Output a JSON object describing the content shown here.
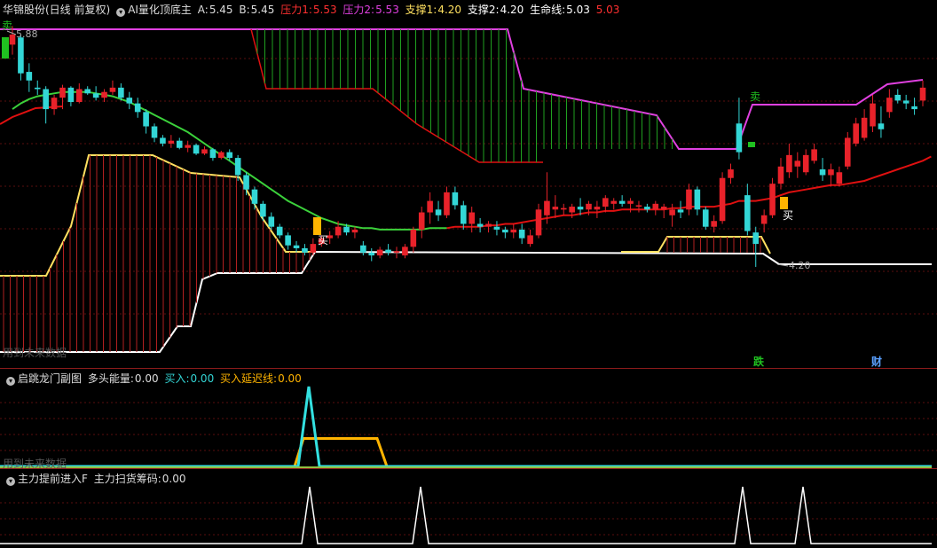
{
  "colors": {
    "up": "#e8222a",
    "down": "#33d6d6",
    "pressure": "#e01010",
    "support": "#ffe060",
    "life": "#3bd13b",
    "resist_top": "#e040e0",
    "white": "#ffffff",
    "buy_yellow": "#ffb400",
    "sell_green": "#20c020"
  },
  "main_header": {
    "stock": "华锦股份(日线 前复权)",
    "indicator": "AI量化顶底主",
    "a_label": "A:",
    "a_value": "5.45",
    "b_label": "B:",
    "b_value": "5.45",
    "p1_label": "压力1:",
    "p1_value": "5.53",
    "p2_label": "压力2:",
    "p2_value": "5.53",
    "s1_label": "支撑1:",
    "s1_value": "4.20",
    "s2_label": "支撑2:",
    "s2_value": "4.20",
    "life_label": "生命线:",
    "life_value": "5.03",
    "extra_value": "5.03"
  },
  "main_labels": {
    "high_price": "5.88",
    "low_price": "4.20",
    "buy": "买",
    "sell": "卖",
    "watermark": "用到未来数据",
    "event_die": "跌",
    "event_cai": "财"
  },
  "sub1_header": {
    "name": "启跳龙门副图",
    "e1_label": "多头能量:",
    "e1_value": "0.00",
    "e2_label": "买入:",
    "e2_value": "0.00",
    "e3_label": "买入延迟线:",
    "e3_value": "0.00",
    "watermark": "用到未来数据"
  },
  "sub2_header": {
    "name": "主力提前进入F",
    "e1_label": "主力扫货筹码:",
    "e1_value": "0.00"
  },
  "chart_data": [
    {
      "type": "candlestick",
      "title": "AI量化顶底主",
      "ylim": [
        3.6,
        5.95
      ],
      "candles": [
        [
          5.75,
          5.88,
          5.68,
          5.82
        ],
        [
          5.8,
          5.82,
          5.5,
          5.55
        ],
        [
          5.56,
          5.62,
          5.42,
          5.5
        ],
        [
          5.45,
          5.5,
          5.4,
          5.44
        ],
        [
          5.44,
          5.46,
          5.2,
          5.3
        ],
        [
          5.3,
          5.4,
          5.26,
          5.38
        ],
        [
          5.38,
          5.47,
          5.3,
          5.45
        ],
        [
          5.45,
          5.46,
          5.32,
          5.35
        ],
        [
          5.35,
          5.48,
          5.34,
          5.44
        ],
        [
          5.44,
          5.46,
          5.4,
          5.41
        ],
        [
          5.41,
          5.46,
          5.36,
          5.38
        ],
        [
          5.38,
          5.44,
          5.35,
          5.42
        ],
        [
          5.42,
          5.5,
          5.4,
          5.45
        ],
        [
          5.45,
          5.48,
          5.36,
          5.38
        ],
        [
          5.38,
          5.42,
          5.3,
          5.34
        ],
        [
          5.34,
          5.38,
          5.24,
          5.28
        ],
        [
          5.28,
          5.3,
          5.13,
          5.18
        ],
        [
          5.18,
          5.2,
          5.07,
          5.1
        ],
        [
          5.1,
          5.12,
          5.04,
          5.06
        ],
        [
          5.06,
          5.12,
          5.03,
          5.08
        ],
        [
          5.08,
          5.1,
          5.02,
          5.03
        ],
        [
          5.03,
          5.08,
          5.0,
          5.05
        ],
        [
          5.05,
          5.06,
          4.98,
          4.99
        ],
        [
          4.99,
          5.04,
          4.98,
          5.02
        ],
        [
          5.02,
          5.03,
          4.94,
          4.96
        ],
        [
          4.96,
          5.01,
          4.95,
          5.0
        ],
        [
          5.0,
          5.02,
          4.94,
          4.96
        ],
        [
          4.96,
          4.98,
          4.8,
          4.84
        ],
        [
          4.84,
          4.86,
          4.7,
          4.74
        ],
        [
          4.74,
          4.76,
          4.6,
          4.64
        ],
        [
          4.64,
          4.66,
          4.52,
          4.55
        ],
        [
          4.55,
          4.58,
          4.46,
          4.48
        ],
        [
          4.48,
          4.5,
          4.4,
          4.42
        ],
        [
          4.42,
          4.44,
          4.32,
          4.35
        ],
        [
          4.35,
          4.38,
          4.3,
          4.33
        ],
        [
          4.33,
          4.36,
          4.28,
          4.3
        ],
        [
          4.3,
          4.4,
          4.28,
          4.36
        ],
        [
          4.36,
          4.42,
          4.34,
          4.4
        ],
        [
          4.4,
          4.45,
          4.36,
          4.42
        ],
        [
          4.42,
          4.52,
          4.4,
          4.48
        ],
        [
          4.48,
          4.5,
          4.42,
          4.44
        ],
        [
          4.44,
          4.48,
          4.4,
          4.46
        ],
        [
          4.35,
          4.38,
          4.28,
          4.3
        ],
        [
          4.3,
          4.33,
          4.24,
          4.28
        ],
        [
          4.28,
          4.34,
          4.26,
          4.32
        ],
        [
          4.32,
          4.36,
          4.28,
          4.3
        ],
        [
          4.3,
          4.34,
          4.26,
          4.31
        ],
        [
          4.28,
          4.36,
          4.26,
          4.34
        ],
        [
          4.34,
          4.48,
          4.3,
          4.46
        ],
        [
          4.46,
          4.62,
          4.4,
          4.58
        ],
        [
          4.58,
          4.72,
          4.5,
          4.66
        ],
        [
          4.6,
          4.66,
          4.52,
          4.56
        ],
        [
          4.56,
          4.76,
          4.54,
          4.72
        ],
        [
          4.72,
          4.76,
          4.6,
          4.63
        ],
        [
          4.63,
          4.66,
          4.46,
          4.5
        ],
        [
          4.5,
          4.62,
          4.44,
          4.58
        ],
        [
          4.5,
          4.54,
          4.44,
          4.48
        ],
        [
          4.48,
          4.52,
          4.44,
          4.5
        ],
        [
          4.48,
          4.52,
          4.42,
          4.46
        ],
        [
          4.46,
          4.48,
          4.4,
          4.44
        ],
        [
          4.44,
          4.5,
          4.4,
          4.46
        ],
        [
          4.46,
          4.5,
          4.36,
          4.4
        ],
        [
          4.36,
          4.46,
          4.34,
          4.42
        ],
        [
          4.42,
          4.64,
          4.4,
          4.6
        ],
        [
          4.56,
          4.86,
          4.5,
          4.66
        ],
        [
          4.6,
          4.7,
          4.54,
          4.62
        ],
        [
          4.6,
          4.64,
          4.56,
          4.61
        ],
        [
          4.58,
          4.64,
          4.54,
          4.62
        ],
        [
          4.62,
          4.68,
          4.56,
          4.6
        ],
        [
          4.6,
          4.66,
          4.56,
          4.64
        ],
        [
          4.6,
          4.66,
          4.54,
          4.62
        ],
        [
          4.62,
          4.7,
          4.58,
          4.68
        ],
        [
          4.64,
          4.68,
          4.6,
          4.66
        ],
        [
          4.66,
          4.7,
          4.62,
          4.64
        ],
        [
          4.64,
          4.68,
          4.58,
          4.66
        ],
        [
          4.62,
          4.66,
          4.58,
          4.63
        ],
        [
          4.62,
          4.64,
          4.58,
          4.6
        ],
        [
          4.6,
          4.66,
          4.56,
          4.64
        ],
        [
          4.6,
          4.64,
          4.54,
          4.62
        ],
        [
          4.56,
          4.64,
          4.48,
          4.6
        ],
        [
          4.6,
          4.66,
          4.54,
          4.58
        ],
        [
          4.6,
          4.78,
          4.56,
          4.74
        ],
        [
          4.74,
          4.76,
          4.56,
          4.6
        ],
        [
          4.6,
          4.62,
          4.46,
          4.48
        ],
        [
          4.48,
          4.56,
          4.44,
          4.52
        ],
        [
          4.52,
          4.86,
          4.5,
          4.82
        ],
        [
          4.82,
          4.92,
          4.78,
          4.88
        ],
        [
          5.2,
          5.38,
          4.95,
          5.0
        ],
        [
          4.7,
          4.78,
          4.42,
          4.45
        ],
        [
          4.44,
          4.48,
          4.2,
          4.36
        ],
        [
          4.5,
          4.6,
          4.44,
          4.56
        ],
        [
          4.56,
          4.82,
          4.54,
          4.78
        ],
        [
          4.78,
          4.96,
          4.74,
          4.9
        ],
        [
          4.86,
          5.06,
          4.82,
          4.98
        ],
        [
          4.9,
          5.0,
          4.82,
          4.94
        ],
        [
          4.86,
          5.02,
          4.84,
          4.98
        ],
        [
          4.94,
          5.06,
          4.92,
          5.02
        ],
        [
          4.88,
          4.96,
          4.8,
          4.84
        ],
        [
          4.84,
          4.92,
          4.76,
          4.88
        ],
        [
          4.78,
          4.9,
          4.76,
          4.86
        ],
        [
          4.9,
          5.14,
          4.88,
          5.1
        ],
        [
          5.06,
          5.24,
          5.04,
          5.2
        ],
        [
          5.1,
          5.3,
          5.08,
          5.24
        ],
        [
          5.18,
          5.4,
          5.14,
          5.34
        ],
        [
          5.2,
          5.32,
          5.1,
          5.16
        ],
        [
          5.28,
          5.44,
          5.24,
          5.38
        ],
        [
          5.4,
          5.44,
          5.34,
          5.36
        ],
        [
          5.36,
          5.4,
          5.3,
          5.34
        ],
        [
          5.32,
          5.38,
          5.26,
          5.3
        ],
        [
          5.36,
          5.5,
          5.32,
          5.45
        ]
      ],
      "life_line": [
        5.3,
        5.34,
        5.37,
        5.39,
        5.4,
        5.41,
        5.42,
        5.42,
        5.42,
        5.42,
        5.41,
        5.4,
        5.39,
        5.37,
        5.35,
        5.32,
        5.29,
        5.26,
        5.23,
        5.2,
        5.17,
        5.14,
        5.1,
        5.06,
        5.02,
        4.98,
        4.94,
        4.9,
        4.86,
        4.82,
        4.78,
        4.74,
        4.7,
        4.66,
        4.63,
        4.6,
        4.57,
        4.54,
        4.52,
        4.5,
        4.49,
        4.48,
        4.47,
        4.47,
        4.46,
        4.46,
        4.46,
        4.46,
        4.46,
        4.46,
        4.47,
        4.47,
        4.47,
        4.48,
        4.48,
        4.48,
        4.48,
        4.49,
        4.49,
        4.5,
        4.5,
        4.51,
        4.52,
        4.53,
        4.54,
        4.55,
        4.56,
        4.56,
        4.57,
        4.58,
        4.58,
        4.59,
        4.59,
        4.6,
        4.6,
        4.6,
        4.6,
        4.6,
        4.6,
        4.61,
        4.61,
        4.62,
        4.62,
        4.62,
        4.62,
        4.63,
        4.64,
        4.66,
        4.66,
        4.66,
        4.67,
        4.68,
        4.7,
        4.72,
        4.73,
        4.74,
        4.75,
        4.76,
        4.77,
        4.77,
        4.78,
        4.79,
        4.8,
        4.82,
        4.84,
        4.86,
        4.88,
        4.9,
        4.92,
        4.94,
        4.97
      ],
      "support_price": 4.2,
      "resist_price": 5.53,
      "high_price": 5.88
    },
    {
      "type": "line",
      "title": "启跳龙门副图",
      "series": [
        {
          "name": "买入",
          "values": [
            0,
            1,
            0
          ]
        },
        {
          "name": "买入延迟线",
          "values": [
            0,
            0.35,
            0.35,
            0
          ]
        }
      ],
      "ylim": [
        0,
        1
      ]
    },
    {
      "type": "line",
      "title": "主力提前进入F",
      "series": [
        {
          "name": "主力扫货筹码",
          "values": [
            0,
            1,
            0,
            1,
            0,
            1,
            0,
            1,
            0
          ]
        }
      ],
      "ylim": [
        0,
        1
      ]
    }
  ]
}
